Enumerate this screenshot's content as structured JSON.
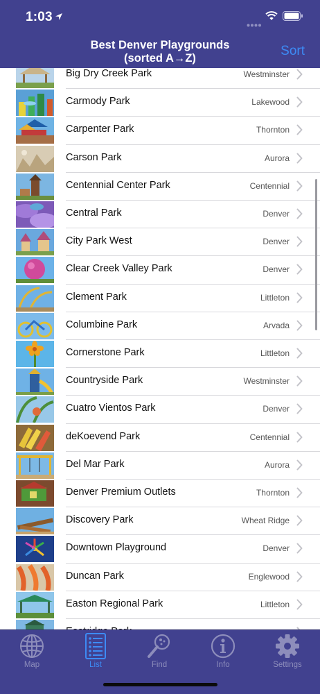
{
  "status_bar": {
    "time": "1:03"
  },
  "nav": {
    "title_line1": "Best Denver Playgrounds",
    "title_line2": "(sorted A→Z)",
    "sort_label": "Sort"
  },
  "rows": [
    {
      "name": "Big Dry Creek Park",
      "city": "Westminster",
      "thumb": "pavilion"
    },
    {
      "name": "Carmody Park",
      "city": "Lakewood",
      "thumb": "posts"
    },
    {
      "name": "Carpenter Park",
      "city": "Thornton",
      "thumb": "canopy"
    },
    {
      "name": "Carson Park",
      "city": "Aurora",
      "thumb": "sand"
    },
    {
      "name": "Centennial Center Park",
      "city": "Centennial",
      "thumb": "tower"
    },
    {
      "name": "Central Park",
      "city": "Denver",
      "thumb": "purple-waves"
    },
    {
      "name": "City Park West",
      "city": "Denver",
      "thumb": "castle"
    },
    {
      "name": "Clear Creek Valley Park",
      "city": "Denver",
      "thumb": "pink-ball"
    },
    {
      "name": "Clement Park",
      "city": "Littleton",
      "thumb": "arches"
    },
    {
      "name": "Columbine Park",
      "city": "Arvada",
      "thumb": "bicycle"
    },
    {
      "name": "Cornerstone Park",
      "city": "Littleton",
      "thumb": "flower"
    },
    {
      "name": "Countryside Park",
      "city": "Westminster",
      "thumb": "slide-tower"
    },
    {
      "name": "Cuatro Vientos Park",
      "city": "Denver",
      "thumb": "green-arcs"
    },
    {
      "name": "deKoevend Park",
      "city": "Centennial",
      "thumb": "yellow-fan"
    },
    {
      "name": "Del Mar Park",
      "city": "Aurora",
      "thumb": "swings"
    },
    {
      "name": "Denver Premium Outlets",
      "city": "Thornton",
      "thumb": "treehouse"
    },
    {
      "name": "Discovery Park",
      "city": "Wheat Ridge",
      "thumb": "logs"
    },
    {
      "name": "Downtown Playground",
      "city": "Denver",
      "thumb": "spinner"
    },
    {
      "name": "Duncan Park",
      "city": "Englewood",
      "thumb": "orange-slides"
    },
    {
      "name": "Easton Regional Park",
      "city": "Littleton",
      "thumb": "green-shade"
    },
    {
      "name": "Eastridge Park",
      "city": "",
      "thumb": "partial"
    }
  ],
  "tabs": [
    {
      "label": "Map",
      "icon": "globe-icon",
      "active": false
    },
    {
      "label": "List",
      "icon": "list-icon",
      "active": true
    },
    {
      "label": "Find",
      "icon": "magnifier-icon",
      "active": false
    },
    {
      "label": "Info",
      "icon": "info-icon",
      "active": false
    },
    {
      "label": "Settings",
      "icon": "gear-icon",
      "active": false
    }
  ],
  "colors": {
    "bar_background": "#41418f",
    "accent": "#3d8bf5",
    "tab_inactive": "#8d8dbb"
  }
}
